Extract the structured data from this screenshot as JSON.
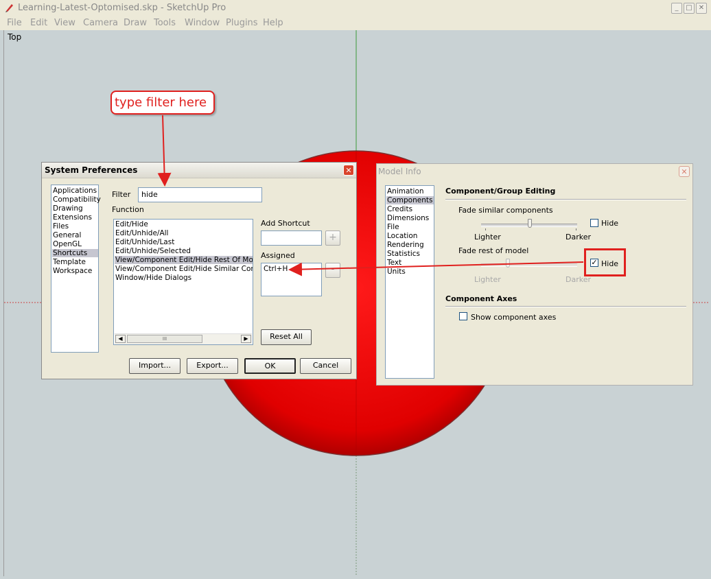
{
  "app": {
    "title": "Learning-Latest-Optomised.skp - SketchUp Pro"
  },
  "menu": [
    "File",
    "Edit",
    "View",
    "Camera",
    "Draw",
    "Tools",
    "Window",
    "Plugins",
    "Help"
  ],
  "viewport": {
    "label": "Top"
  },
  "callout": {
    "text": "type filter here"
  },
  "prefs": {
    "title": "System Preferences",
    "categories": [
      "Applications",
      "Compatibility",
      "Drawing",
      "Extensions",
      "Files",
      "General",
      "OpenGL",
      "Shortcuts",
      "Template",
      "Workspace"
    ],
    "filter_label": "Filter",
    "filter_value": "hide",
    "function_label": "Function",
    "functions": [
      "Edit/Hide",
      "Edit/Unhide/All",
      "Edit/Unhide/Last",
      "Edit/Unhide/Selected",
      "View/Component Edit/Hide Rest Of Model",
      "View/Component Edit/Hide Similar Components",
      "Window/Hide Dialogs"
    ],
    "add_shortcut_label": "Add Shortcut",
    "assigned_label": "Assigned",
    "assigned_value": "Ctrl+H",
    "plus": "+",
    "minus": "-",
    "reset_all": "Reset All",
    "import": "Import...",
    "export": "Export...",
    "ok": "OK",
    "cancel": "Cancel",
    "scroll_thumb": "III"
  },
  "model_info": {
    "title": "Model Info",
    "categories": [
      "Animation",
      "Components",
      "Credits",
      "Dimensions",
      "File",
      "Location",
      "Rendering",
      "Statistics",
      "Text",
      "Units"
    ],
    "section1": "Component/Group Editing",
    "fade_similar": "Fade similar components",
    "lighter": "Lighter",
    "darker": "Darker",
    "hide": "Hide",
    "fade_rest": "Fade rest of model",
    "section2": "Component Axes",
    "show_axes": "Show component axes"
  }
}
